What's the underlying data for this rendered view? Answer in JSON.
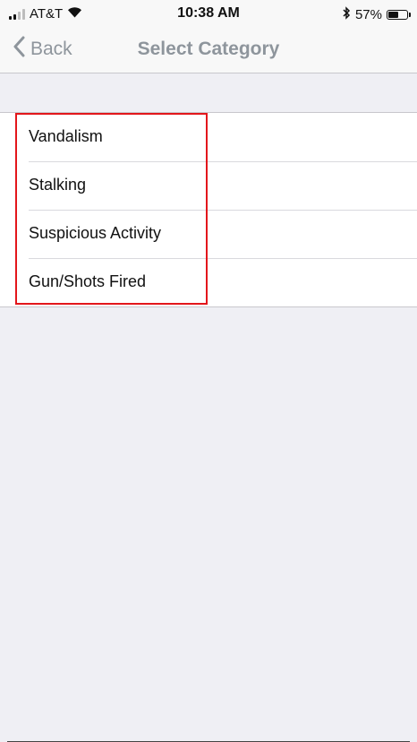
{
  "status_bar": {
    "carrier": "AT&T",
    "time": "10:38 AM",
    "battery_percent": "57%",
    "battery_level": 0.57,
    "icons": [
      "signal-icon",
      "wifi-icon",
      "bluetooth-icon",
      "battery-icon"
    ]
  },
  "nav": {
    "back_label": "Back",
    "title": "Select Category",
    "tint_color": "#8e959c"
  },
  "categories": [
    {
      "label": "Vandalism"
    },
    {
      "label": "Stalking"
    },
    {
      "label": "Suspicious Activity"
    },
    {
      "label": "Gun/Shots Fired"
    }
  ],
  "highlight_color": "#e3161b"
}
